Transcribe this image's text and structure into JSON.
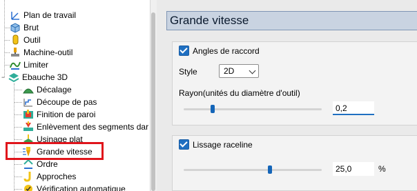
{
  "tree": {
    "items": [
      {
        "label": "Plan de travail",
        "icon": "axis-icon"
      },
      {
        "label": "Brut",
        "icon": "cube-icon"
      },
      {
        "label": "Outil",
        "icon": "tool-icon"
      },
      {
        "label": "Machine-outil",
        "icon": "machine-icon"
      },
      {
        "label": "Limiter",
        "icon": "limit-icon"
      },
      {
        "label": "Ebauche 3D",
        "icon": "layers-icon",
        "expanded_symbol": "−"
      },
      {
        "label": "Décalage",
        "icon": "offset-icon"
      },
      {
        "label": "Découpe de pas",
        "icon": "stepcut-icon"
      },
      {
        "label": "Finition de paroi",
        "icon": "wall-finish-icon"
      },
      {
        "label": "Enlèvement des segments dar",
        "icon": "segment-removal-icon"
      },
      {
        "label": "Usinage plat",
        "icon": "flat-machining-icon"
      },
      {
        "label": "Grande vitesse",
        "icon": "high-speed-icon"
      },
      {
        "label": "Ordre",
        "icon": "order-icon"
      },
      {
        "label": "Approches",
        "icon": "approach-icon"
      },
      {
        "label": "Vérification automatique",
        "icon": "check-icon"
      }
    ]
  },
  "panel": {
    "title": "Grande vitesse",
    "angles": {
      "checkbox_label": "Angles de raccord",
      "checked": true,
      "style_label": "Style",
      "style_value": "2D",
      "radius_label": "Rayon(unités du diamètre d'outil)",
      "radius_value": "0,2"
    },
    "lissage": {
      "checkbox_label": "Lissage raceline",
      "checked": true,
      "value": "25,0",
      "unit": "%"
    }
  },
  "colors": {
    "highlight_border": "#e0141b",
    "title_bar": "#c9d3e1",
    "accent": "#1f6fc1"
  }
}
